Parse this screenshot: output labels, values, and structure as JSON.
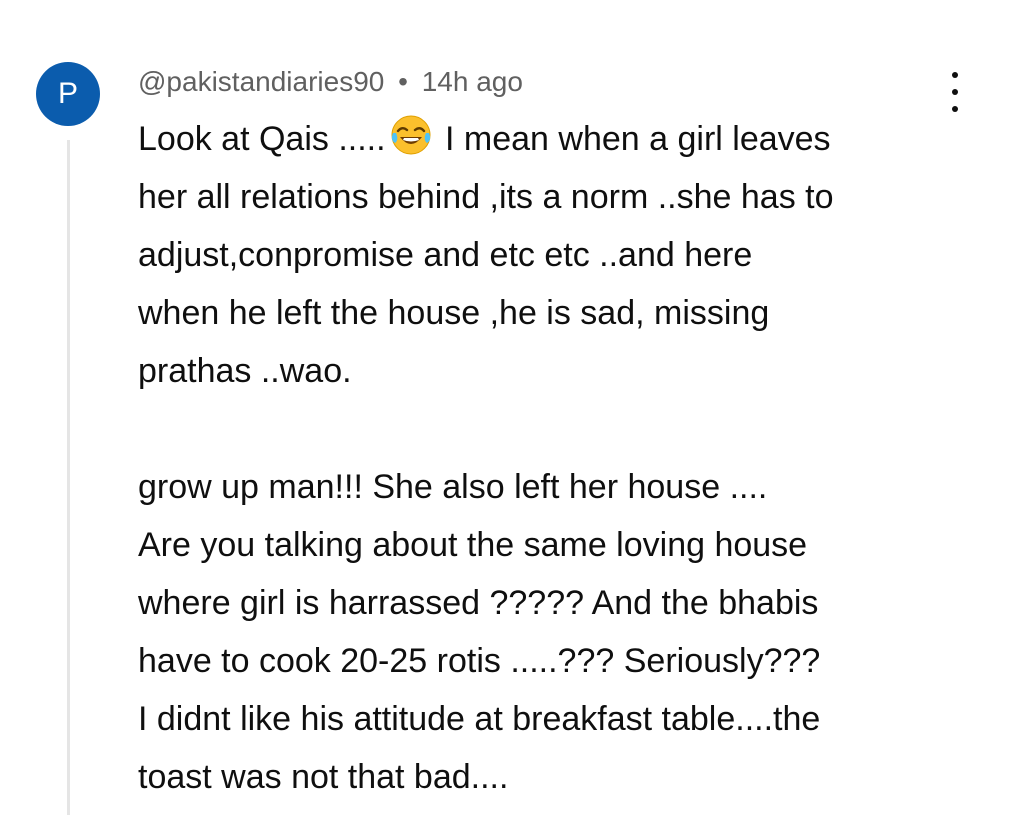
{
  "comment": {
    "avatar_letter": "P",
    "avatar_color": "#0b5cad",
    "author": "@pakistandiaries90",
    "separator": "•",
    "time_ago": "14h ago",
    "menu_icon": "more-vertical-icon",
    "emoji_icon": "face-with-tears-of-joy-emoji",
    "paragraph1": {
      "line1_before_emoji": "Look at Qais .....",
      "line1_after_emoji": " I mean when a girl leaves",
      "lines": [
        "her all relations behind ,its a norm ..she has to",
        "adjust,conpromise and etc etc ..and here",
        "when he left the house ,he is sad, missing",
        "prathas ..wao."
      ]
    },
    "paragraph2": {
      "lines": [
        "grow up man!!! She also left her house ....",
        "Are you talking about the same loving house",
        "where girl is harrassed ????? And the bhabis",
        "have to cook 20-25 rotis .....??? Seriously???",
        "I didnt like his attitude at breakfast table....the",
        "toast was not that bad...."
      ]
    }
  }
}
